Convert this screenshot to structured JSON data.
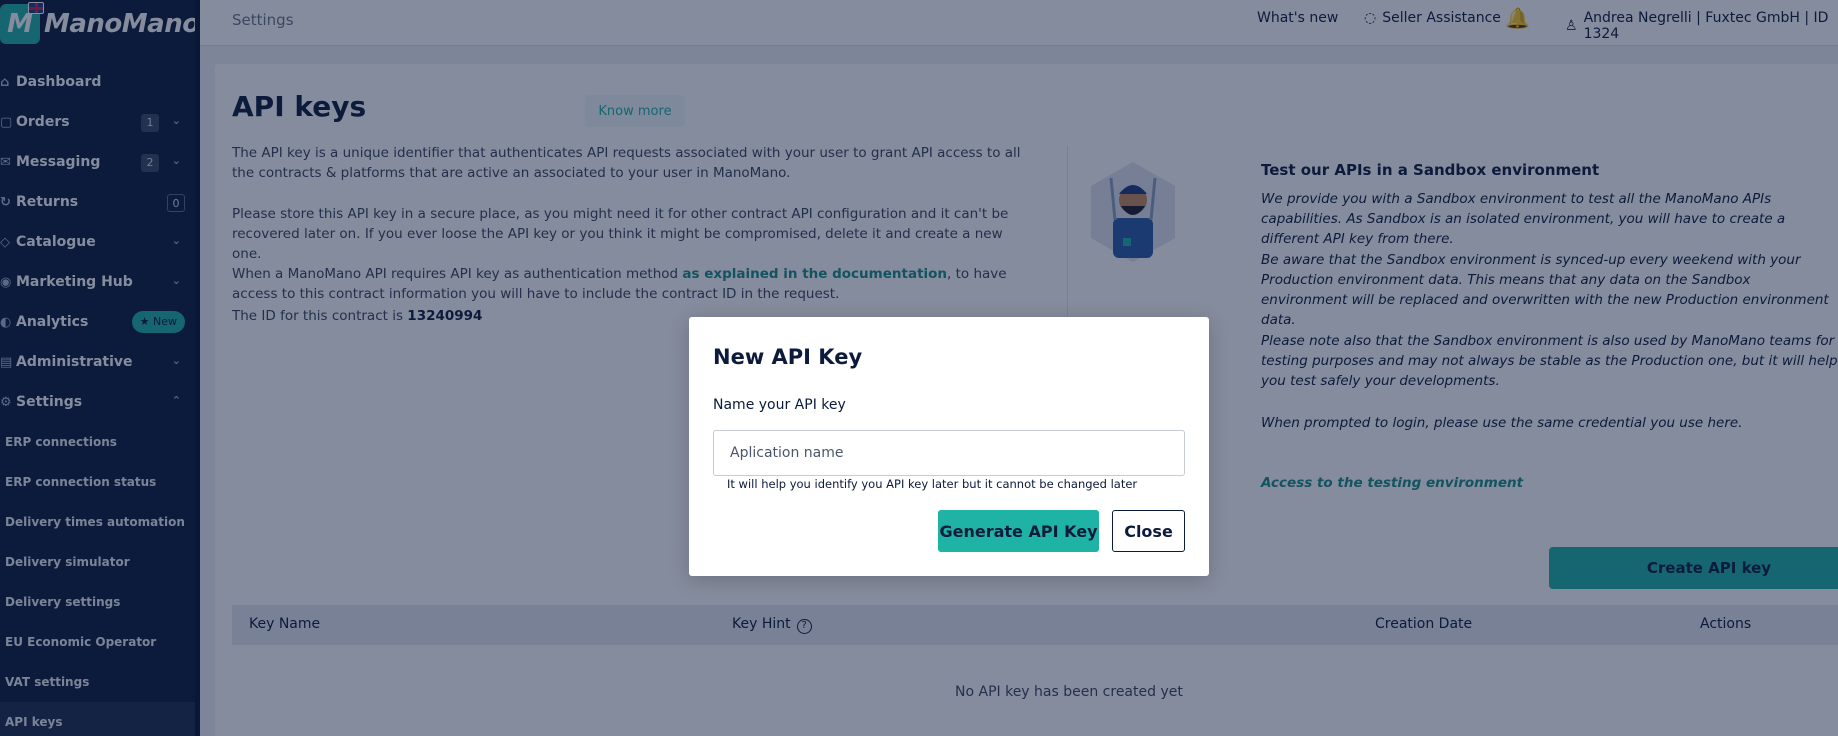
{
  "brand": {
    "name": "ManoMano"
  },
  "sidebar": {
    "items": [
      {
        "label": "Dashboard",
        "icon": "dashboard-icon"
      },
      {
        "label": "Orders",
        "icon": "box-icon",
        "badge": "1"
      },
      {
        "label": "Messaging",
        "icon": "envelope-icon",
        "badge": "2"
      },
      {
        "label": "Returns",
        "icon": "return-icon",
        "badge": "0"
      },
      {
        "label": "Catalogue",
        "icon": "tag-icon"
      },
      {
        "label": "Marketing Hub",
        "icon": "megaphone-icon"
      },
      {
        "label": "Analytics",
        "icon": "chart-icon",
        "pill": "★ New"
      },
      {
        "label": "Administrative",
        "icon": "document-icon"
      },
      {
        "label": "Settings",
        "icon": "gear-icon"
      }
    ],
    "subitems": [
      "ERP connections",
      "ERP connection status",
      "Delivery times automation",
      "Delivery simulator",
      "Delivery settings",
      "EU Economic Operator",
      "VAT settings",
      "API keys"
    ]
  },
  "topbar": {
    "breadcrumb": "Settings",
    "whats_new": "What's new",
    "seller_assistance": "Seller Assistance",
    "user": "Andrea Negrelli | Fuxtec GmbH | ID 1324"
  },
  "main": {
    "title": "API keys",
    "know_more": "Know more",
    "p1": "The API key is a unique identifier that authenticates API requests associated with your user to grant API access to all the contracts & platforms that are active an associated to your user in ManoMano.",
    "p2": "Please store this API key in a secure place, as you might need it for other contract API configuration and it can't be recovered later on. If you ever loose the API key or you think it might be compromised, delete it and create a new one.",
    "p3_pre": "When a ManoMano API requires API key as authentication method ",
    "p3_link": "as explained in the documentation",
    "p3_post": ", to have access to this contract information you will have to include the contract ID in the request.",
    "p4_pre": "The ID for this contract is ",
    "contract_id": "13240994",
    "sandbox": {
      "title": "Test our APIs in a Sandbox environment",
      "t1": "We provide you with a Sandbox environment to test all the ManoMano APIs capabilities. As Sandbox is an isolated environment, you will have to create a different API key from there.",
      "t2": "Be aware that the Sandbox environment is synced-up every weekend with your Production environment data. This means that any data on the Sandbox environment will be replaced and overwritten with the new Production environment data.",
      "t3": "Please note also that the Sandbox environment is also used by ManoMano teams for testing purposes and may not always be stable as the Production one, but it will help you test safely your developments.",
      "t4": "When prompted to login, please use the same credential you use here.",
      "link": "Access to the testing environment"
    },
    "create_button": "Create API key",
    "table": {
      "columns": [
        "Key Name",
        "Key Hint",
        "Creation Date",
        "Actions"
      ],
      "empty": "No API key has been created yet"
    }
  },
  "modal": {
    "title": "New API Key",
    "label": "Name your API key",
    "placeholder": "Aplication name",
    "value": "",
    "help": "It will help you identify you API key later but it cannot be changed later",
    "generate": "Generate API Key",
    "close": "Close"
  },
  "colors": {
    "accent": "#1fb3a6",
    "navy": "#0c1a3b"
  }
}
